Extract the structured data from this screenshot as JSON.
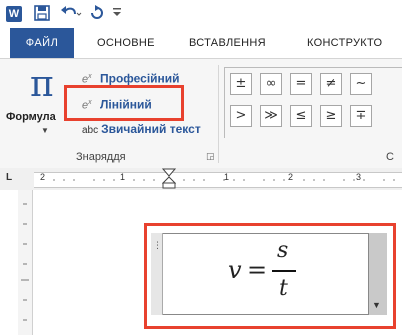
{
  "qat": {
    "logo": "W",
    "save_icon": "save-icon",
    "undo_icon": "undo-icon",
    "redo_icon": "redo-icon",
    "customize_icon": "customize-icon"
  },
  "tabs": [
    {
      "label": "ФАЙЛ"
    },
    {
      "label": "ОСНОВНЕ"
    },
    {
      "label": "ВСТАВЛЕННЯ"
    },
    {
      "label": "КОНСТРУКТО"
    }
  ],
  "ribbon": {
    "formula_label": "Формула",
    "options": {
      "professional": "Професійний",
      "linear": "Лінійний",
      "normal_text_prefix": "abc",
      "normal_text": "Звичайний текст"
    },
    "group_tools": "Знаряддя",
    "group_symbols_short": "С",
    "symbols_row1": [
      "±",
      "∞",
      "=",
      "≠",
      "~"
    ],
    "symbols_row2": [
      ">",
      "≫",
      "≤",
      "≥",
      "∓"
    ]
  },
  "ruler": {
    "numbers": [
      "2",
      "1",
      "1",
      "2",
      "3"
    ]
  },
  "equation": {
    "lhs": "v",
    "op": "=",
    "numerator": "s",
    "denominator": "t"
  },
  "colors": {
    "accent": "#2b579a",
    "highlight": "#e8412e"
  }
}
